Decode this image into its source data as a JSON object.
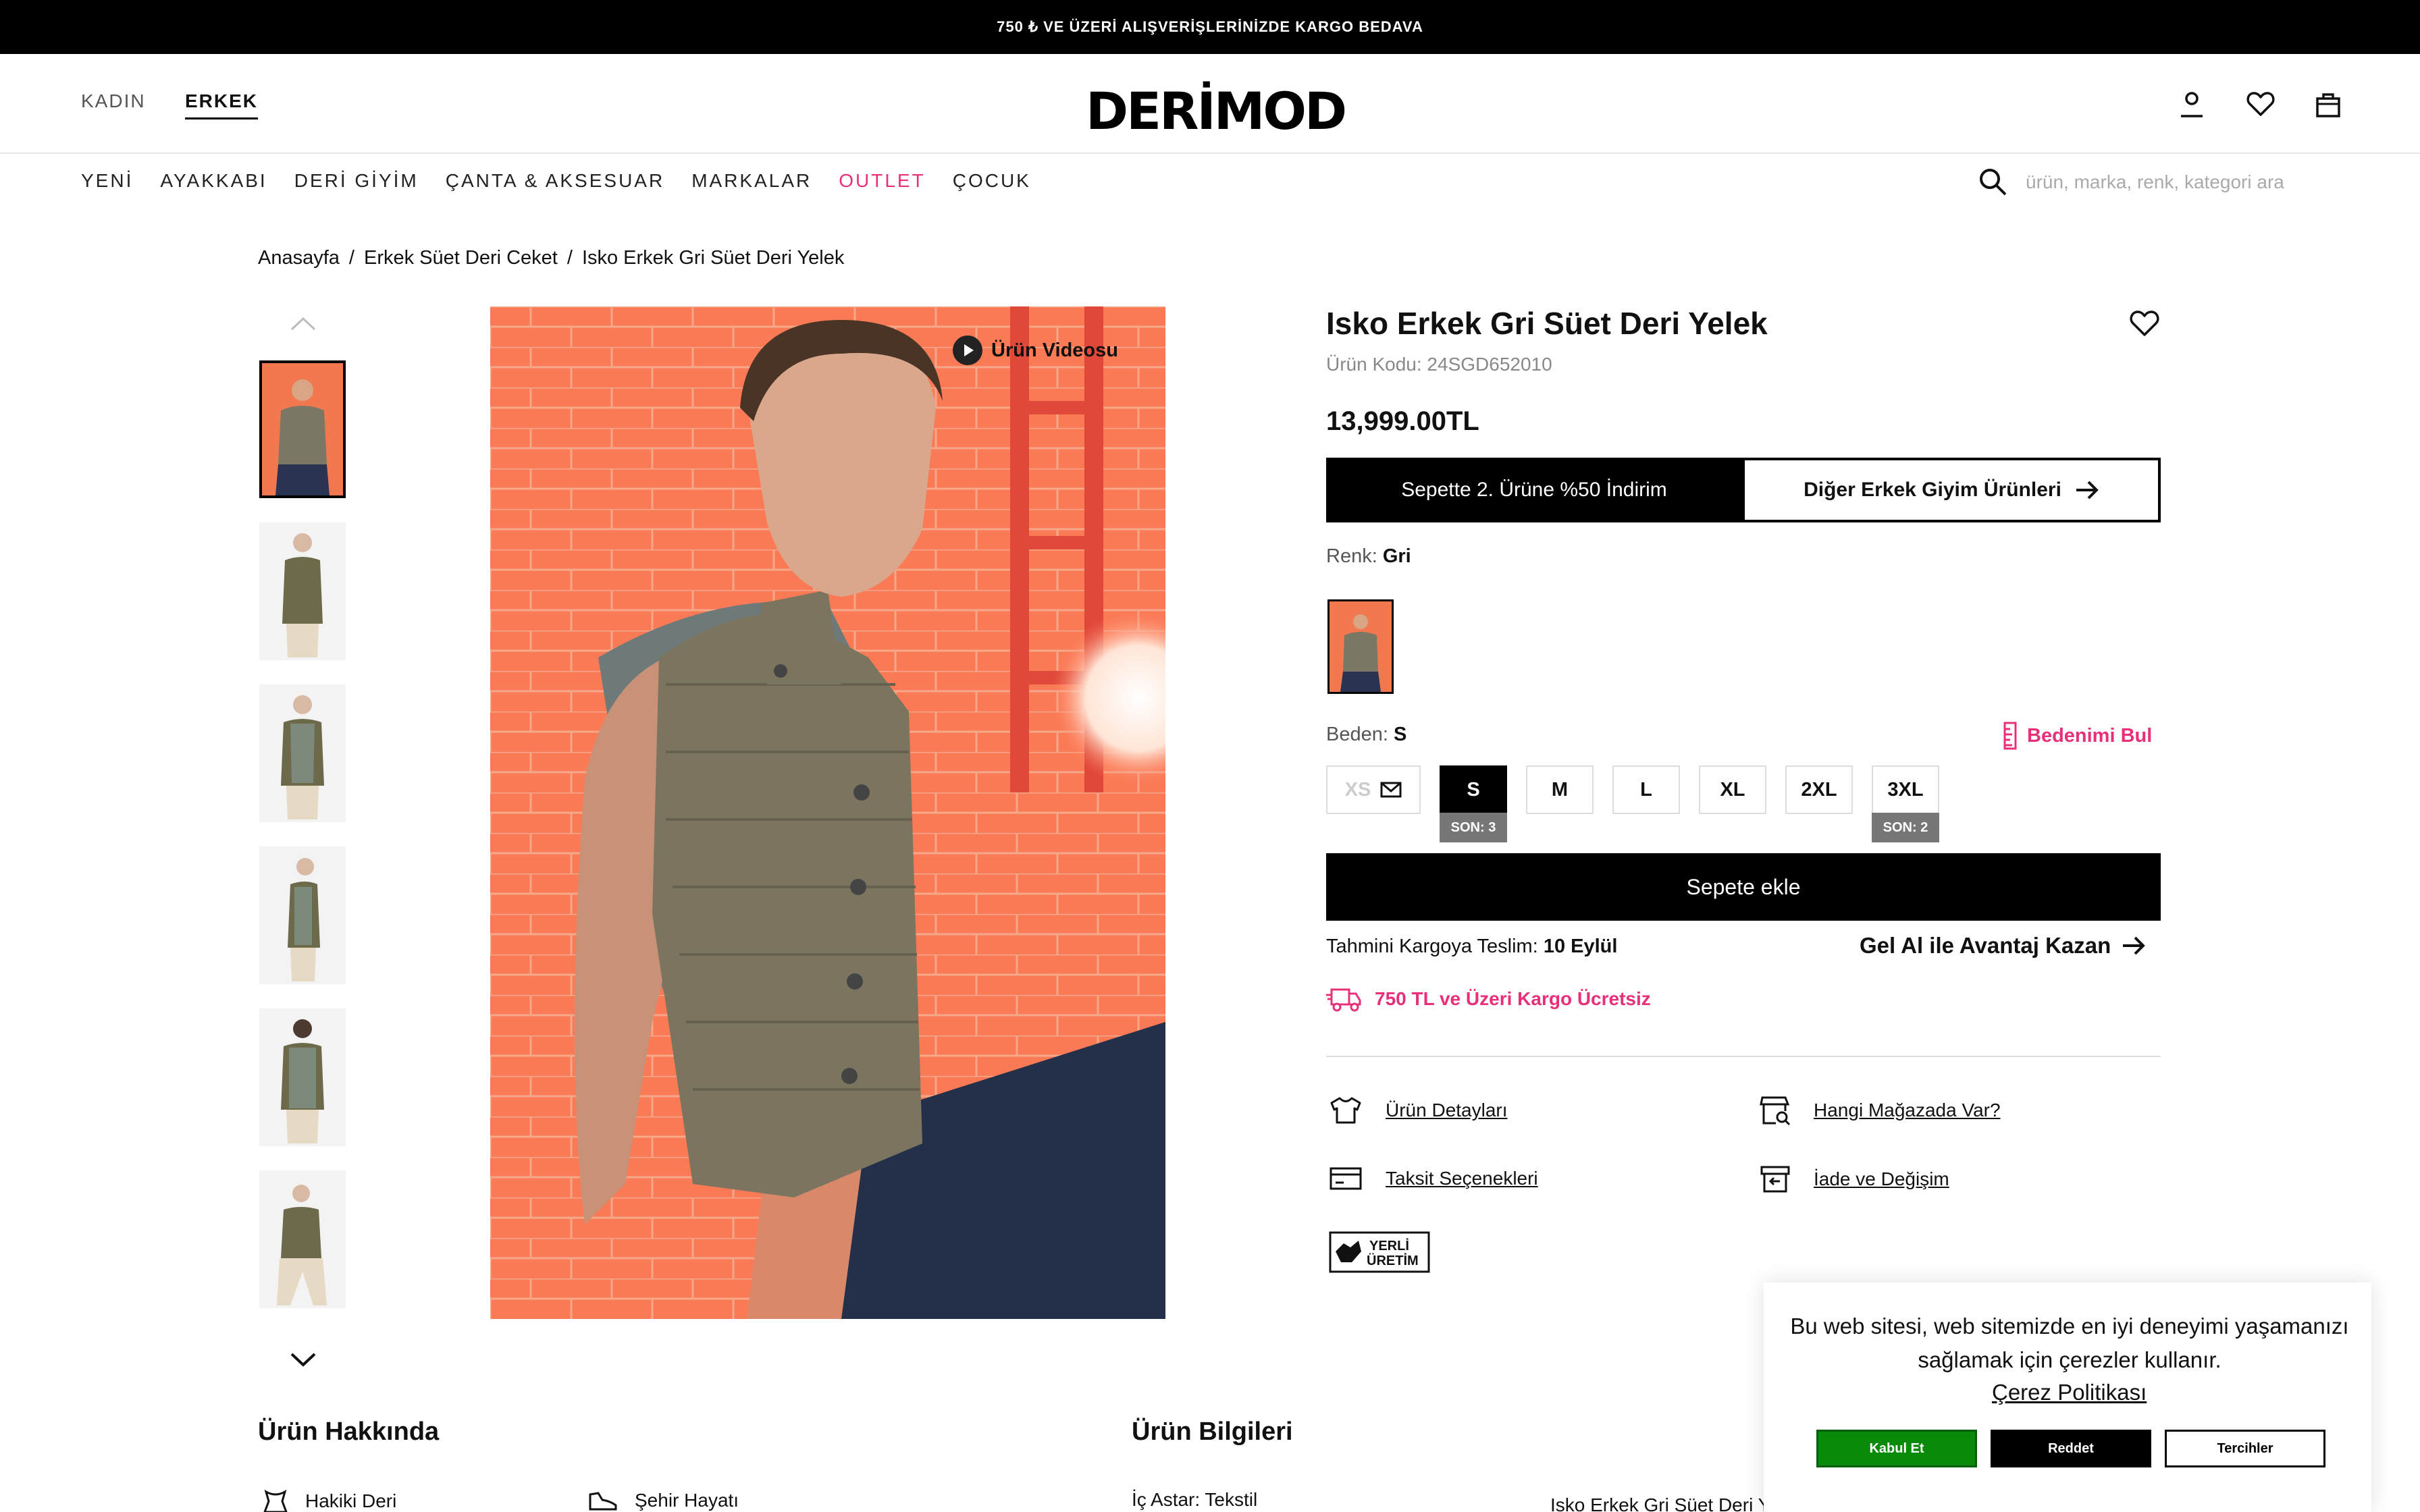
{
  "topbar": {
    "text": "750 ₺ VE ÜZERİ ALIŞVERİŞLERİNİZDE KARGO BEDAVA"
  },
  "header": {
    "gender_tabs": [
      "KADIN",
      "ERKEK"
    ],
    "logo": "DERİMOD",
    "icons": [
      "user-icon",
      "heart-icon",
      "bag-icon"
    ]
  },
  "nav": {
    "items": [
      "YENİ",
      "AYAKKABI",
      "DERİ GİYİM",
      "ÇANTA & AKSESUAR",
      "MARKALAR",
      "OUTLET",
      "ÇOCUK"
    ],
    "outlet_color": "#e8307a"
  },
  "search": {
    "placeholder": "ürün, marka, renk, kategori ara"
  },
  "breadcrumb": [
    "Anasayfa",
    "/",
    "Erkek Süet Deri Ceket",
    "/",
    "Isko Erkek Gri Süet Deri Yelek"
  ],
  "gallery": {
    "video_label": "Ürün Videosu",
    "thumb_count": 6
  },
  "product": {
    "title": "Isko Erkek Gri Süet Deri Yelek",
    "code": "Ürün Kodu: 24SGD652010",
    "price": "13,999.00TL",
    "promo_left": "Sepette 2. Ürüne %50 İndirim",
    "promo_right": "Diğer Erkek Giyim Ürünleri",
    "color_label": "Renk:",
    "color_value": "Gri",
    "size_label": "Beden:",
    "size_value": "S",
    "size_finder": "Bedenimi Bul",
    "sizes": [
      "XS",
      "S",
      "M",
      "L",
      "XL",
      "2XL",
      "3XL"
    ],
    "stock_s": "SON: 3",
    "stock_3xl": "SON: 2",
    "add_to_cart": "Sepete ekle",
    "delivery_label": "Tahmini Kargoya Teslim:",
    "delivery_date": "10 Eylül",
    "gel_al": "Gel Al ile Avantaj Kazan",
    "free_shipping": "750 TL ve Üzeri Kargo Ücretsiz",
    "links": [
      "Ürün Detayları",
      "Hangi Mağazada Var?",
      "Taksit Seçenekleri",
      "İade ve Değişim"
    ],
    "badge_line1": "YERLİ",
    "badge_line2": "ÜRETİM",
    "accent": "#e8307a"
  },
  "bottom": {
    "about_title": "Ürün Hakkında",
    "info_title": "Ürün Bilgileri",
    "about_items": [
      "Hakiki Deri",
      "Şehir Hayatı"
    ],
    "info_items": [
      "İç Astar: Tekstil"
    ],
    "description": "Isko Erkek Gri Süet Deri Yelek, zarif ve rahat bir görünüm sunmak"
  },
  "cookie": {
    "text": "Bu web sitesi, web sitemizde en iyi deneyimi yaşamanızı sağlamak için çerezler kullanır.",
    "policy": "Çerez Politikası",
    "accept": "Kabul Et",
    "reject": "Reddet",
    "prefs": "Tercihler",
    "accept_color": "#0a8a0a"
  }
}
